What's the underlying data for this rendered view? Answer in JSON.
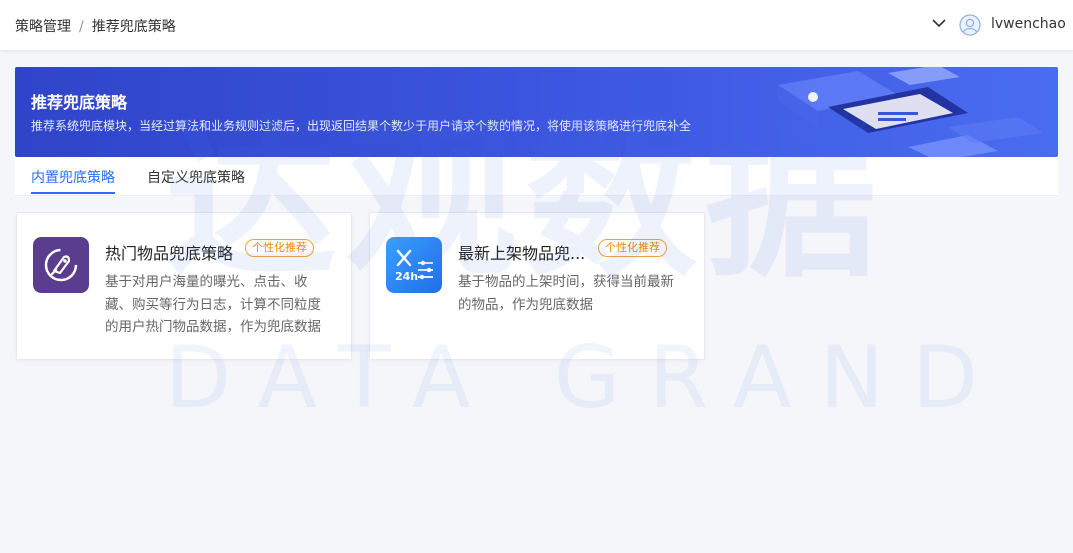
{
  "header": {
    "breadcrumb": [
      "策略管理",
      "推荐兜底策略"
    ],
    "breadcrumb_sep": "/",
    "username": "lvwenchao"
  },
  "banner": {
    "title": "推荐兜底策略",
    "description": "推荐系统兜底模块，当经过算法和业务规则过滤后，出现返回结果个数少于用户请求个数的情况，将使用该策略进行兜底补全"
  },
  "tabs": [
    {
      "label": "内置兜底策略",
      "active": true
    },
    {
      "label": "自定义兜底策略",
      "active": false
    }
  ],
  "cards": [
    {
      "title": "热门物品兜底策略",
      "tag": "个性化推荐",
      "description": "基于对用户海量的曝光、点击、收藏、购买等行为日志，计算不同粒度的用户热门物品数据，作为兜底数据",
      "icon": "hot-items-icon"
    },
    {
      "title": "最新上架物品兜...",
      "tag": "个性化推荐",
      "description": "基于物品的上架时间，获得当前最新的物品，作为兜底数据",
      "icon": "new-items-24h-icon",
      "icon_text": "24h"
    }
  ],
  "watermark": {
    "cn": "达观数据",
    "en": "DATA GRAND"
  },
  "colors": {
    "accent": "#2f6bff",
    "banner": "#3d57e0",
    "tag": "#e8890c",
    "card1_icon": "#5a3d8f",
    "card2_icon": "#2d8cf0"
  }
}
